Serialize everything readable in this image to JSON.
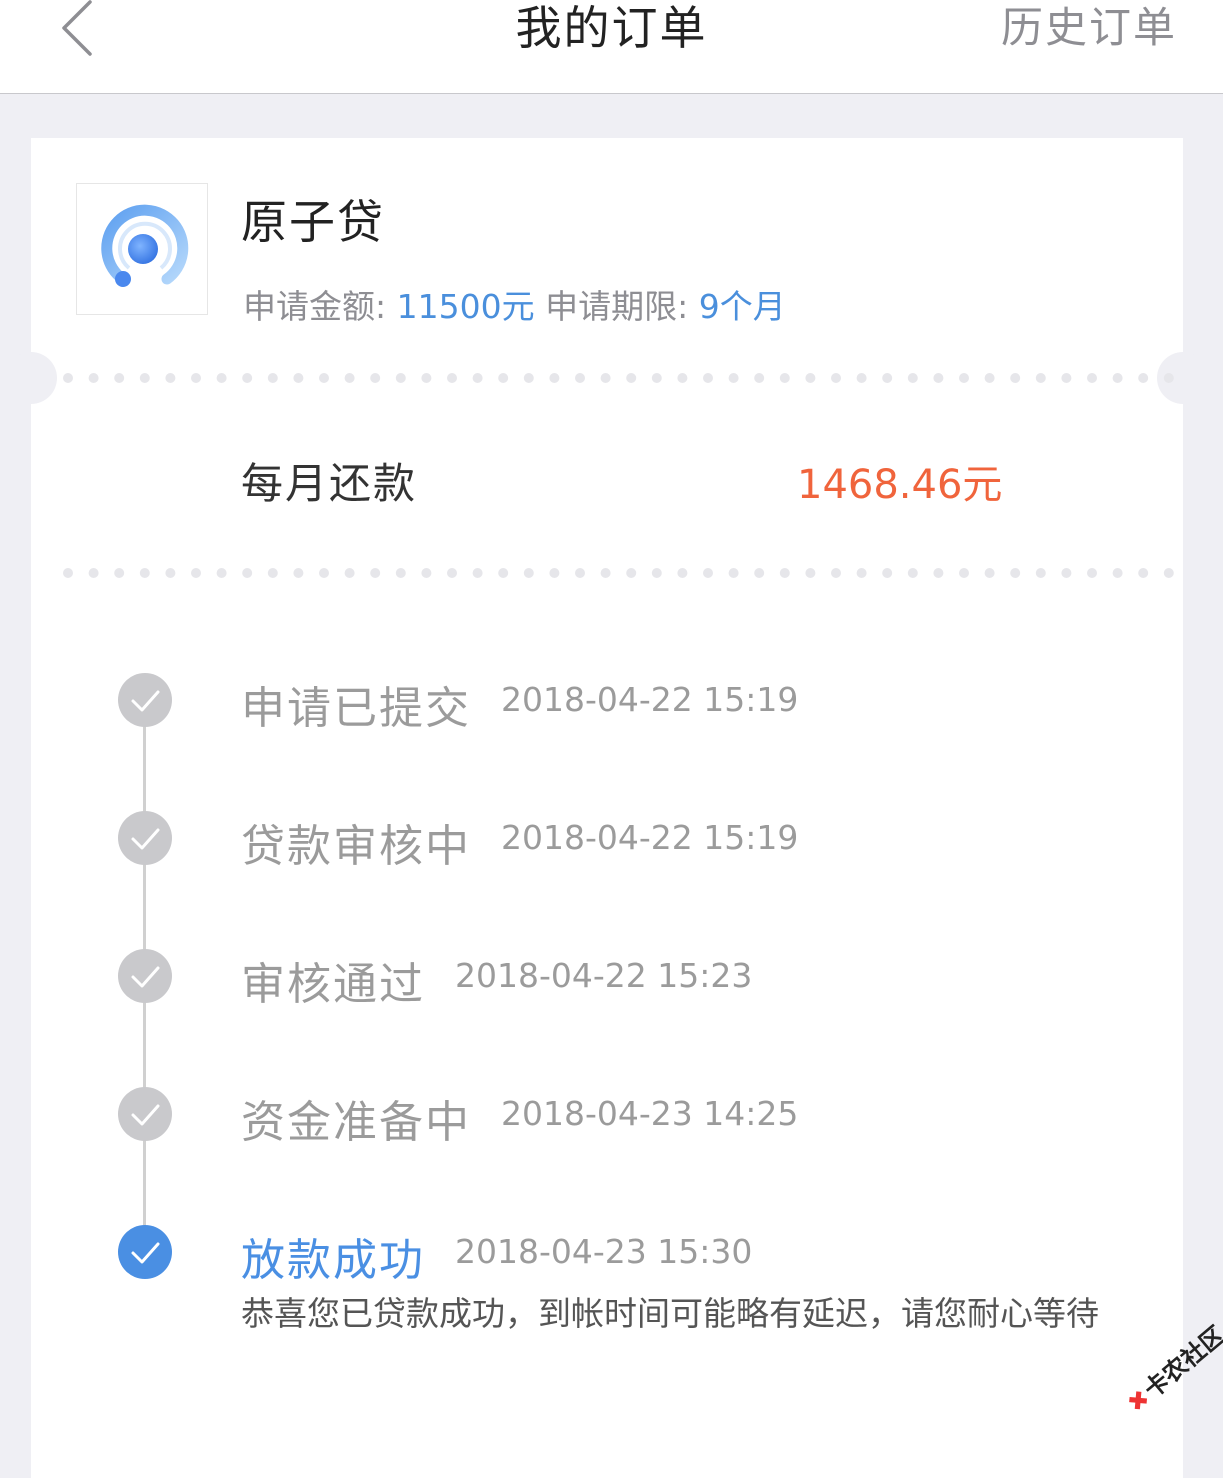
{
  "header": {
    "title": "我的订单",
    "history_label": "历史订单"
  },
  "order": {
    "product_name": "原子贷",
    "amount_label": "申请金额:",
    "amount_value": "11500元",
    "term_label": "申请期限:",
    "term_value": "9个月",
    "monthly_label": "每月还款",
    "monthly_value": "1468.46元"
  },
  "timeline": {
    "steps": [
      {
        "title": "申请已提交",
        "time": "2018-04-22 15:19"
      },
      {
        "title": "贷款审核中",
        "time": "2018-04-22 15:19"
      },
      {
        "title": "审核通过",
        "time": "2018-04-22 15:23"
      },
      {
        "title": "资金准备中",
        "time": "2018-04-23 14:25"
      },
      {
        "title": "放款成功",
        "time": "2018-04-23 15:30"
      }
    ],
    "success_message": "恭喜您已贷款成功，到帐时间可能略有延迟，请您耐心等待"
  },
  "watermark": {
    "text": "卡农社区"
  },
  "colors": {
    "accent": "#4a8fe3",
    "amount": "#f0643c",
    "inactive": "#c9c9cc"
  },
  "icons": {
    "back": "chevron-left-icon",
    "step": "check-circle-icon",
    "logo": "atom-loan-logo"
  }
}
